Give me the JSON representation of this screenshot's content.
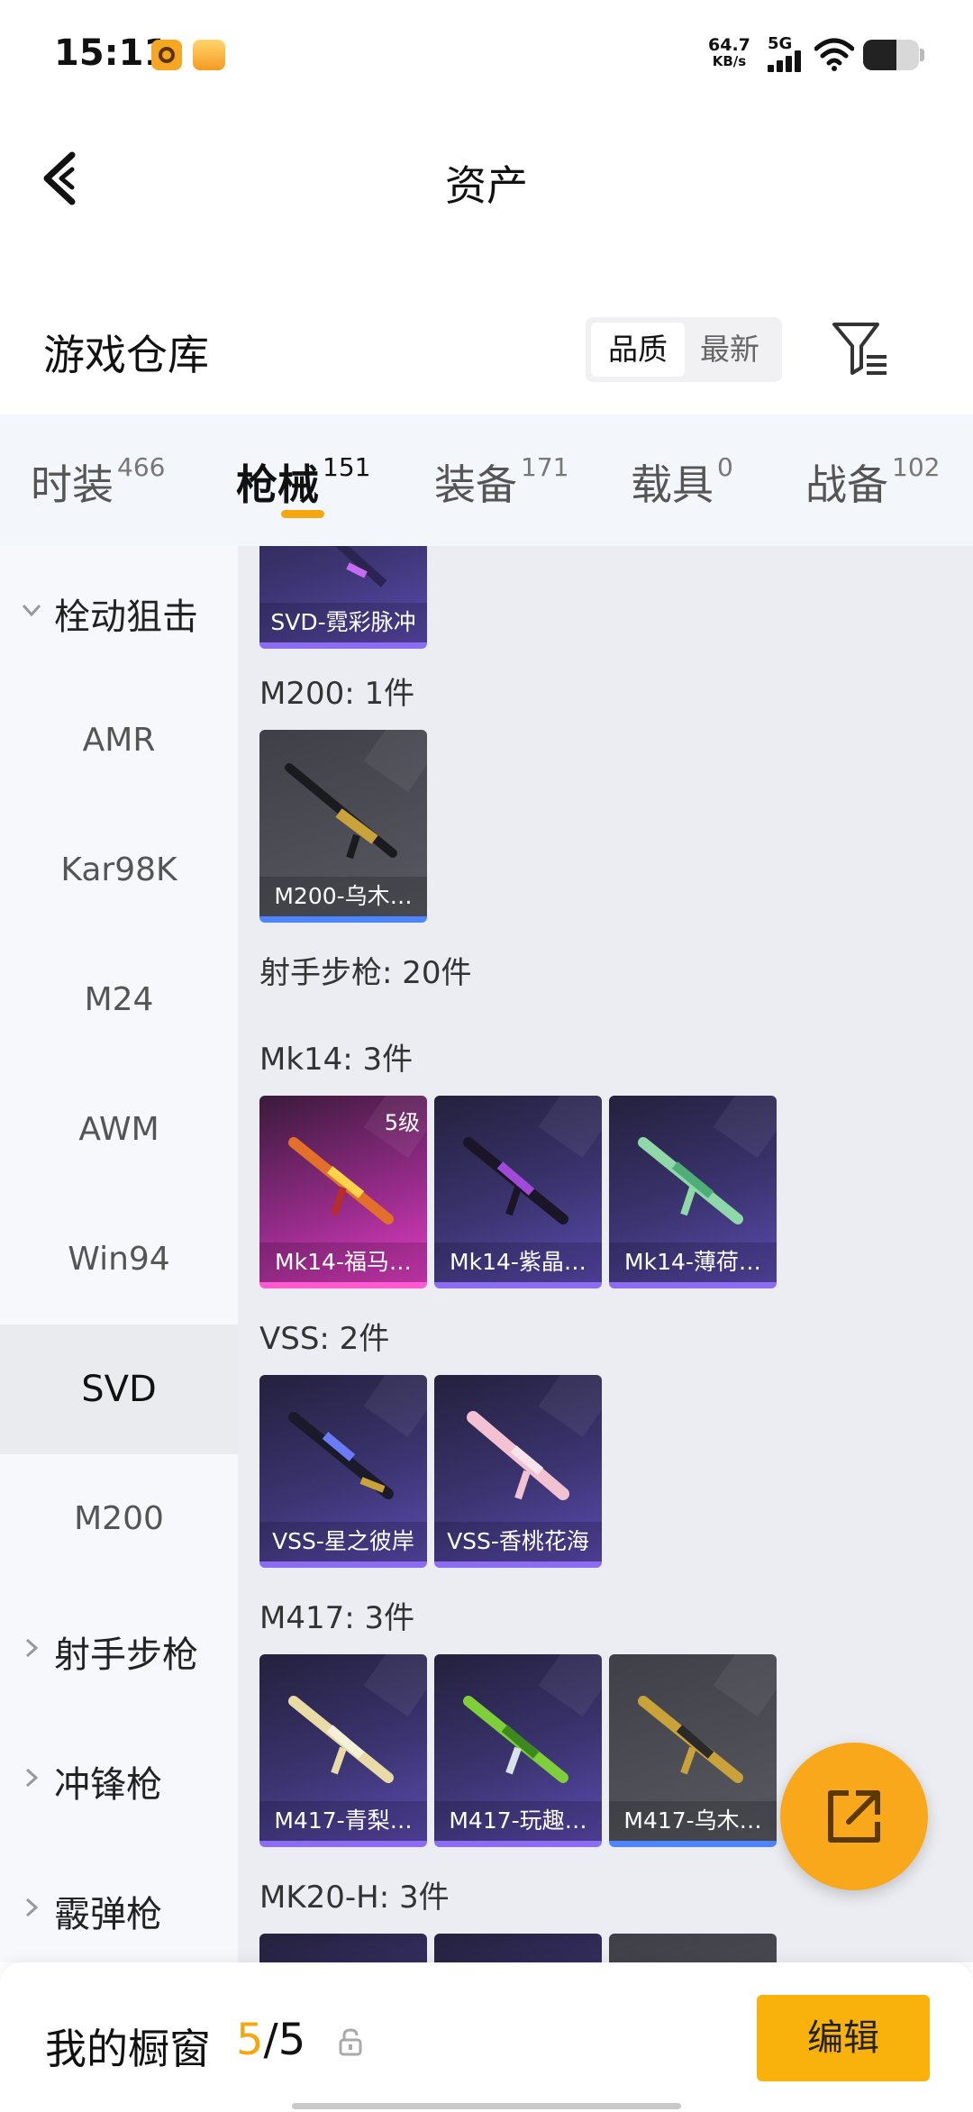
{
  "status_bar": {
    "time": "15:11",
    "net_speed_value": "64.7",
    "net_speed_unit": "KB/s",
    "network_type": "5G",
    "battery_level": 0.6
  },
  "header": {
    "title": "资产",
    "back_icon": "chevron-left-icon"
  },
  "warehouse": {
    "title": "游戏仓库",
    "sort_options": [
      "品质",
      "最新"
    ],
    "selected_sort": "品质",
    "filter_icon": "filter-icon"
  },
  "tabs": [
    {
      "label": "时装",
      "count": "466"
    },
    {
      "label": "枪械",
      "count": "151",
      "active": true
    },
    {
      "label": "装备",
      "count": "171"
    },
    {
      "label": "载具",
      "count": "0"
    },
    {
      "label": "战备",
      "count": "102"
    }
  ],
  "sidebar": {
    "groups": [
      {
        "label": "栓动狙击",
        "expanded": true
      },
      {
        "label": "射手步枪",
        "expanded": false
      },
      {
        "label": "冲锋枪",
        "expanded": false
      },
      {
        "label": "霰弹枪",
        "expanded": false
      }
    ],
    "sub_items": [
      "AMR",
      "Kar98K",
      "M24",
      "AWM",
      "Win94",
      "SVD",
      "M200"
    ],
    "selected": "SVD"
  },
  "content": {
    "sections": [
      {
        "title": "",
        "items": [
          {
            "name": "SVD-霓彩脉冲",
            "rarity": "purple"
          }
        ]
      },
      {
        "title": "M200: 1件",
        "items": [
          {
            "name": "M200-乌木…",
            "rarity": "gray"
          }
        ]
      },
      {
        "title": "射手步枪: 20件",
        "items": []
      },
      {
        "title": "Mk14: 3件",
        "items": [
          {
            "name": "Mk14-福马…",
            "rarity": "pink",
            "level": "5级"
          },
          {
            "name": "Mk14-紫晶…",
            "rarity": "purple"
          },
          {
            "name": "Mk14-薄荷…",
            "rarity": "purple"
          }
        ]
      },
      {
        "title": "VSS: 2件",
        "items": [
          {
            "name": "VSS-星之彼岸",
            "rarity": "purple"
          },
          {
            "name": "VSS-香桃花海",
            "rarity": "purple"
          }
        ]
      },
      {
        "title": "M417: 3件",
        "items": [
          {
            "name": "M417-青梨…",
            "rarity": "purple"
          },
          {
            "name": "M417-玩趣…",
            "rarity": "purple"
          },
          {
            "name": "M417-乌木…",
            "rarity": "gray"
          }
        ]
      },
      {
        "title": "MK20-H: 3件",
        "items": []
      }
    ]
  },
  "fab": {
    "icon": "share-icon"
  },
  "bottom_bar": {
    "label": "我的橱窗",
    "count_current": "5",
    "count_separator": "/",
    "count_total": "5",
    "lock_icon": "lock-icon",
    "edit_label": "编辑"
  },
  "colors": {
    "accent": "#f5a70f",
    "purple_rarity": "#8b6cf2",
    "gray_rarity": "#4d84ff",
    "pink_rarity": "#ff5ad1"
  }
}
